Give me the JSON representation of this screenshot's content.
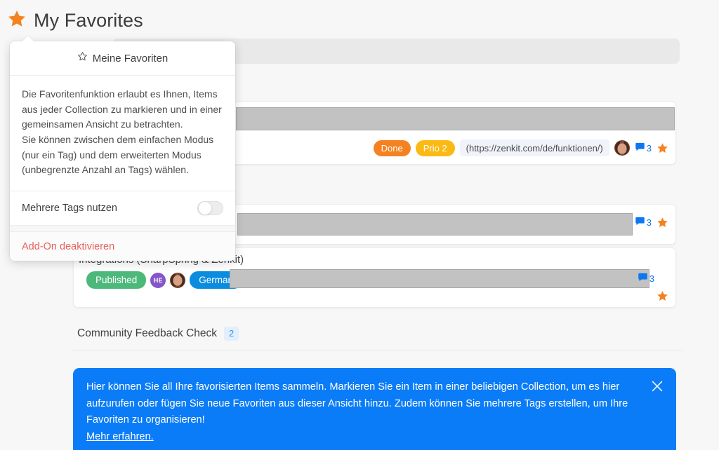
{
  "page": {
    "title": "My Favorites",
    "title_icon": "star-icon",
    "accent_orange": "#f58220",
    "accent_blue": "#0b7cf7"
  },
  "popup": {
    "header_title": "Meine Favoriten",
    "header_icon": "star-outline-icon",
    "description_1": "Die Favoritenfunktion erlaubt es Ihnen, Items aus jeder Collection zu markieren und in einer gemeinsamen Ansicht zu betrachten.",
    "description_2": "Sie können zwischen dem einfachen Modus (nur ein Tag) und dem erweiterten Modus (unbegrenzte Anzahl an Tags) wählen.",
    "toggle_label": "Mehrere Tags nutzen",
    "toggle_state": "off",
    "deactivate_label": "Add-On deaktivieren",
    "deactivate_color": "#e8605b"
  },
  "cards": [
    {
      "id": "card-1",
      "tags": [
        {
          "label": "Done",
          "color": "#f58220"
        },
        {
          "label": "Prio 2",
          "color": "#fbba13"
        }
      ],
      "url_chip": "(https://zenkit.com/de/funktionen/)",
      "avatar": "user-avatar",
      "comment_count": "3",
      "starred": true
    },
    {
      "id": "card-2",
      "comment_count": "3",
      "starred": true
    },
    {
      "id": "card-3",
      "title": "Integrations (SharpSpring & Zenkit)",
      "tags": [
        {
          "label": "Published",
          "color": "#4cb97b"
        },
        {
          "label": "German",
          "color": "#0b8cdf"
        }
      ],
      "member_initials": "HE",
      "avatar": "user-avatar",
      "comment_count": "3",
      "starred": true
    }
  ],
  "section": {
    "title": "Community Feedback Check",
    "count": "2"
  },
  "banner": {
    "text": "Hier können Sie all Ihre favorisierten Items sammeln. Markieren Sie ein Item in einer beliebigen Collection, um es hier aufzurufen oder fügen Sie neue Favoriten aus dieser Ansicht hinzu. Zudem können Sie mehrere Tags erstellen, um Ihre Favoriten zu organisieren!",
    "link_label": "Mehr erfahren.",
    "close_icon": "close-icon",
    "background": "#0b7cf7"
  }
}
